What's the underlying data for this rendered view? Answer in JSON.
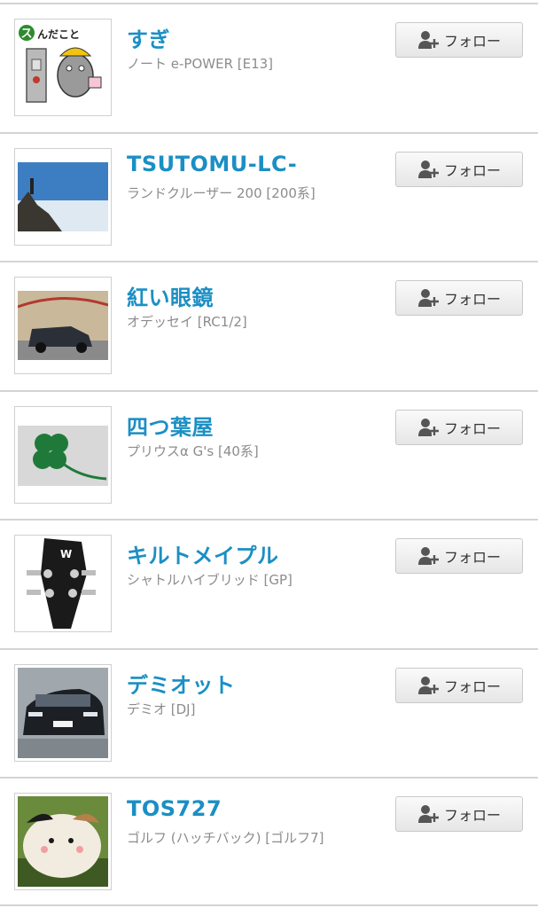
{
  "follow_label": "フォロー",
  "users": [
    {
      "name": "すぎ",
      "car": "ノート e-POWER [E13]",
      "thumb_text": "スんだこと"
    },
    {
      "name": "TSUTOMU-LC-",
      "car": "ランドクルーザー 200 [200系]"
    },
    {
      "name": "紅い眼鏡",
      "car": "オデッセイ [RC1/2]"
    },
    {
      "name": "四つ葉屋",
      "car": "プリウスα G's [40系]"
    },
    {
      "name": "キルトメイプル",
      "car": "シャトルハイブリッド [GP]"
    },
    {
      "name": "デミオット",
      "car": "デミオ [DJ]"
    },
    {
      "name": "TOS727",
      "car": "ゴルフ (ハッチバック) [ゴルフ7]"
    }
  ]
}
